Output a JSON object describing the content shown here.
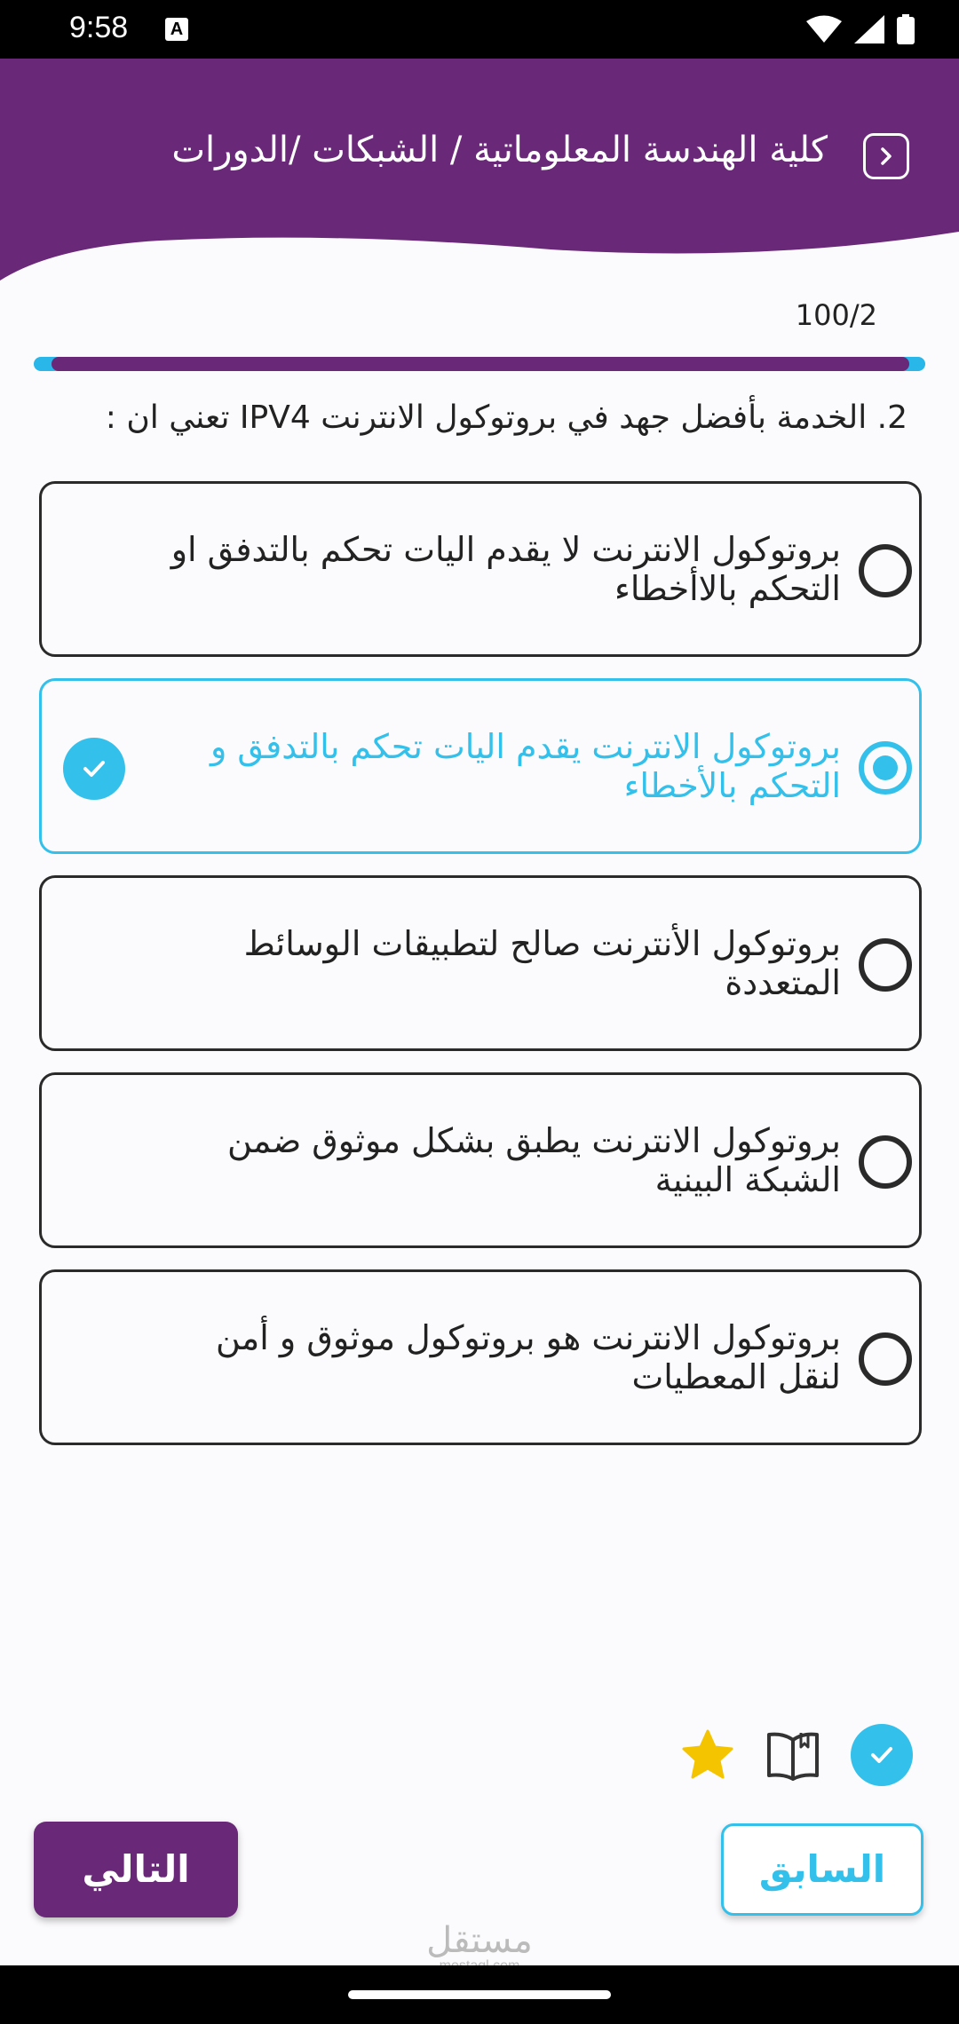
{
  "status": {
    "time": "9:58",
    "a_badge": "A"
  },
  "header": {
    "title": "كلية الهندسة المعلوماتية / الشبكات /الدورات",
    "color": "#6a2878"
  },
  "progress": {
    "label": "100/2",
    "fraction": 0.98
  },
  "question": {
    "text": "2. الخدمة بأفضل جهد في بروتوكول الانترنت IPV4 تعني ان :"
  },
  "options": [
    {
      "text": "بروتوكول الانترنت لا يقدم اليات تحكم بالتدفق او التحكم بالاأخطاء",
      "selected": false
    },
    {
      "text": "بروتوكول الانترنت يقدم اليات تحكم بالتدفق و التحكم بالأخطاء",
      "selected": true
    },
    {
      "text": "بروتوكول الأنترنت صالح لتطبيقات الوسائط المتعددة",
      "selected": false
    },
    {
      "text": "بروتوكول الانترنت يطبق بشكل موثوق ضمن الشبكة البينية",
      "selected": false
    },
    {
      "text": "بروتوكول الانترنت هو بروتوكول موثوق و أمن لنقل المعطيات",
      "selected": false
    }
  ],
  "buttons": {
    "previous": "السابق",
    "next": "التالي"
  },
  "watermark": {
    "arabic": "مستقل",
    "latin": "mostaql.com"
  },
  "colors": {
    "accent": "#33c0ea",
    "brand": "#6a2878",
    "star": "#f5c400"
  }
}
